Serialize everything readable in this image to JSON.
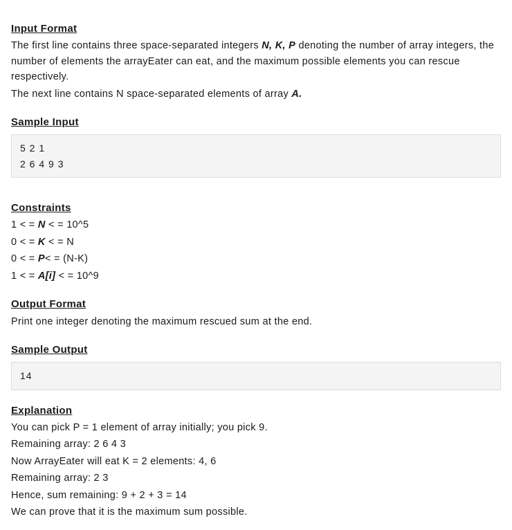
{
  "input_format": {
    "heading": "Input Format",
    "p1a": "The first line contains three space-separated integers ",
    "nkp": "N, K, P",
    "p1b": " denoting the number of array integers, the number of elements the arrayEater can eat, and the maximum possible elements you can rescue respectively.",
    "p2a": "The next line contains N space-separated elements of array ",
    "a": "A.",
    "p2b": ""
  },
  "sample_input": {
    "heading": "Sample Input",
    "content": "5 2 1\n2 6 4 9 3"
  },
  "constraints": {
    "heading": "Constraints",
    "c1a": "1 < = ",
    "c1b": "N",
    "c1c": " < = 10^5",
    "c2a": "0 < = ",
    "c2b": "K",
    "c2c": " < = N",
    "c3a": "0 < = ",
    "c3b": "P",
    "c3c": "< = (N-K)",
    "c4a": "1 < = ",
    "c4b": "A[i]",
    "c4c": " < = 10^9"
  },
  "output_format": {
    "heading": "Output Format",
    "text": "Print one integer denoting the maximum rescued sum at the end."
  },
  "sample_output": {
    "heading": "Sample Output",
    "content": "14"
  },
  "explanation": {
    "heading": "Explanation",
    "l1": "You can pick P = 1 element of array initially; you pick 9.",
    "l2": "Remaining array: 2 6 4 3",
    "l3": "Now ArrayEater will eat K = 2 elements: 4, 6",
    "l4": "Remaining array: 2 3",
    "l5": "Hence, sum remaining: 9 + 2 + 3 = 14",
    "l6": "We can prove that it is the maximum sum possible."
  }
}
